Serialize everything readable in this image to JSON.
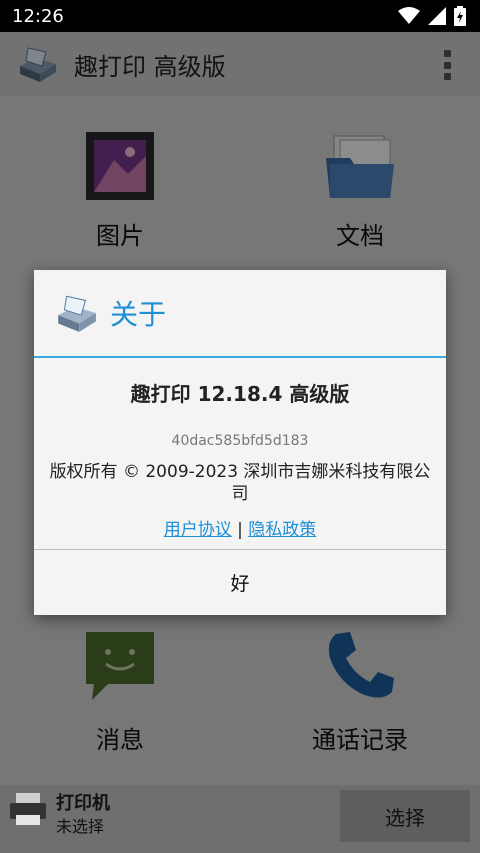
{
  "status_bar": {
    "time": "12:26"
  },
  "app_bar": {
    "title": "趣打印 高级版"
  },
  "tiles": {
    "pictures": "图片",
    "documents": "文档",
    "messages": "消息",
    "call_log": "通话记录"
  },
  "bottom_bar": {
    "printer_label": "打印机",
    "printer_status": "未选择",
    "select_button": "选择"
  },
  "dialog": {
    "title": "关于",
    "app_name": "趣打印 12.18.4 高级版",
    "build_hash": "40dac585bfd5d183",
    "copyright": "版权所有 © 2009-2023 深圳市吉娜米科技有限公司",
    "link_terms": "用户协议",
    "link_separator": "|",
    "link_privacy": "隐私政策",
    "ok_button": "好"
  }
}
